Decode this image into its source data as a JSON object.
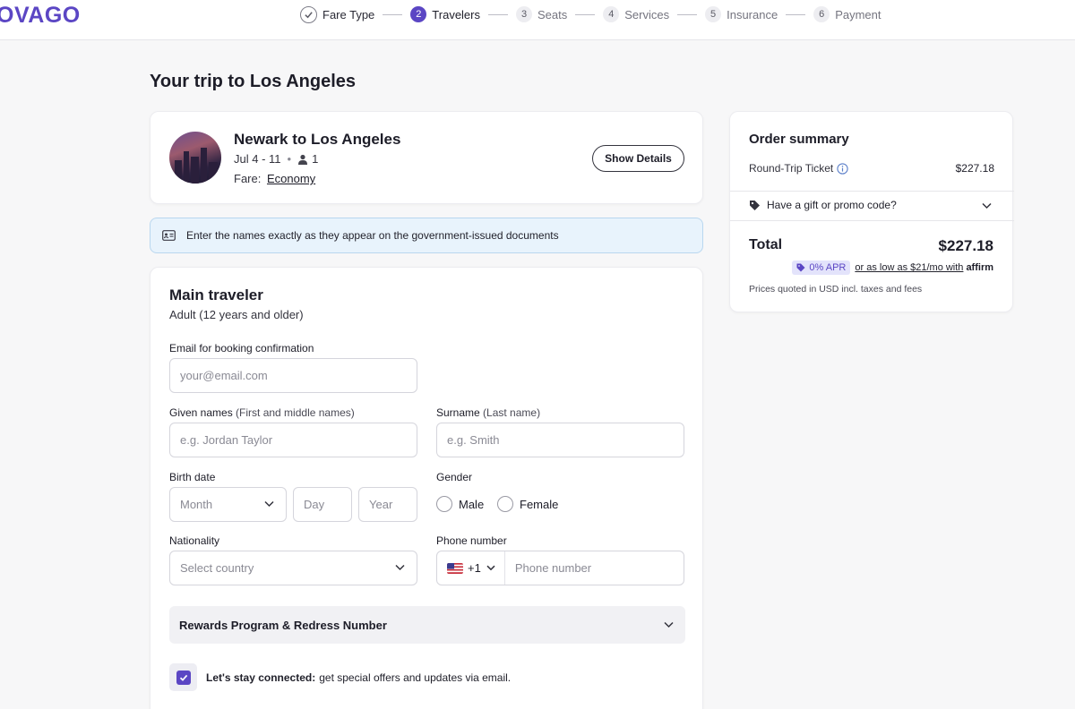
{
  "header": {
    "logo": "OVAGO",
    "steps": [
      {
        "num": "",
        "label": "Fare Type",
        "state": "done"
      },
      {
        "num": "2",
        "label": "Travelers",
        "state": "active"
      },
      {
        "num": "3",
        "label": "Seats",
        "state": "todo"
      },
      {
        "num": "4",
        "label": "Services",
        "state": "todo"
      },
      {
        "num": "5",
        "label": "Insurance",
        "state": "todo"
      },
      {
        "num": "6",
        "label": "Payment",
        "state": "todo"
      }
    ]
  },
  "page": {
    "title": "Your trip to Los Angeles"
  },
  "trip": {
    "route": "Newark to Los Angeles",
    "dates": "Jul 4 - 11",
    "travelers": "1",
    "fare_label": "Fare:",
    "fare_value": "Economy",
    "show_details": "Show Details"
  },
  "notice": {
    "text": "Enter the names exactly as they appear on the government-issued documents"
  },
  "traveler": {
    "title": "Main traveler",
    "subtitle": "Adult (12 years and older)",
    "email_label": "Email for booking confirmation",
    "email_placeholder": "your@email.com",
    "given_label": "Given names",
    "given_hint": "(First and middle names)",
    "given_placeholder": "e.g. Jordan Taylor",
    "surname_label": "Surname",
    "surname_hint": "(Last name)",
    "surname_placeholder": "e.g. Smith",
    "birth_label": "Birth date",
    "month_placeholder": "Month",
    "day_placeholder": "Day",
    "year_placeholder": "Year",
    "gender_label": "Gender",
    "gender_options": [
      "Male",
      "Female"
    ],
    "nationality_label": "Nationality",
    "nationality_placeholder": "Select country",
    "phone_label": "Phone number",
    "phone_prefix": "+1",
    "phone_placeholder": "Phone number",
    "rewards": "Rewards Program & Redress Number",
    "stay_bold": "Let's stay connected:",
    "stay_text": "get special offers and updates via email."
  },
  "summary": {
    "title": "Order summary",
    "ticket_label": "Round-Trip Ticket",
    "ticket_price": "$227.18",
    "promo": "Have a gift or promo code?",
    "total_label": "Total",
    "total_value": "$227.18",
    "apr_badge": "0% APR",
    "apr_text": "or as low as $21/mo with",
    "affirm": "affirm",
    "note": "Prices quoted in USD incl. taxes and fees"
  },
  "colors": {
    "brand": "#5b46c4",
    "notice_bg": "#e8f3fc",
    "notice_border": "#b9d7ef"
  }
}
